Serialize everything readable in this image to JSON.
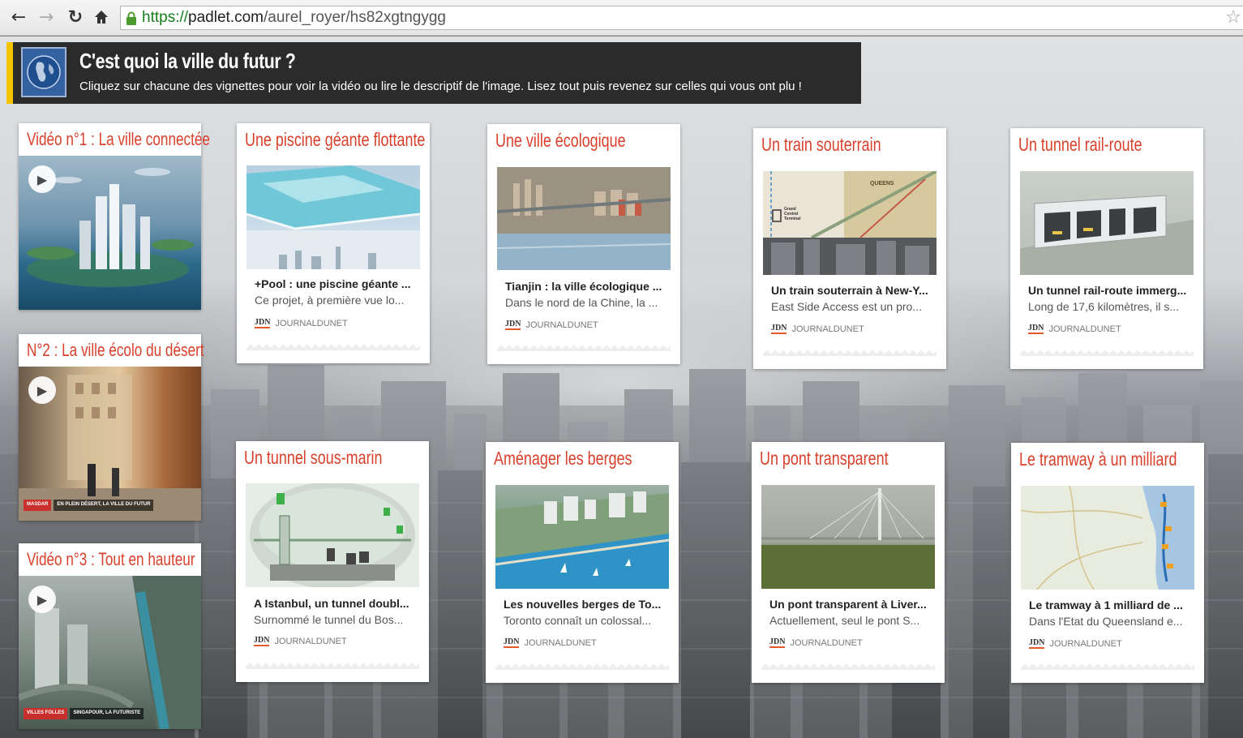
{
  "browser": {
    "url_scheme": "https://",
    "url_host": "padlet.com",
    "url_path": "/aurel_royer/hs82xgtngygg"
  },
  "header": {
    "title": "C'est quoi la ville du futur ?",
    "subtitle": "Cliquez sur chacune des vignettes pour voir la vidéo ou lire le descriptif de l'image. Lisez tout puis revenez sur celles qui vous ont plu !"
  },
  "videos": [
    {
      "title": "Vidéo n°1 : La ville connectée",
      "captions": []
    },
    {
      "title": "N°2 : La ville écolo du désert",
      "captions": [
        "MASDAR",
        "EN PLEIN DÉSERT, LA VILLE DU FUTUR"
      ]
    },
    {
      "title": "Vidéo n°3 : Tout en hauteur",
      "captions": [
        "VILLES FOLLES",
        "SINGAPOUR, LA FUTURISTE"
      ]
    }
  ],
  "cards": [
    {
      "title": "Une piscine géante flottante",
      "link_title": "+Pool : une piscine géante ...",
      "link_desc": "Ce projet, à première vue lo...",
      "source": "JOURNALDUNET",
      "logo": "JDN"
    },
    {
      "title": "Une ville écologique",
      "link_title": "Tianjin : la ville écologique ...",
      "link_desc": "Dans le nord de la Chine, la ...",
      "source": "JOURNALDUNET",
      "logo": "JDN"
    },
    {
      "title": "Un train souterrain",
      "link_title": "Un train souterrain à New-Y...",
      "link_desc": "East Side Access est un pro...",
      "source": "JOURNALDUNET",
      "logo": "JDN",
      "map_labels": [
        "QUEENS",
        "Grand Central Terminal"
      ]
    },
    {
      "title": "Un tunnel rail-route",
      "link_title": "Un tunnel rail-route immerg...",
      "link_desc": "Long de 17,6 kilomètres, il s...",
      "source": "JOURNALDUNET",
      "logo": "JDN"
    },
    {
      "title": "Un tunnel sous-marin",
      "link_title": "A Istanbul, un tunnel doubl...",
      "link_desc": "Surnommé le tunnel du Bos...",
      "source": "JOURNALDUNET",
      "logo": "JDN"
    },
    {
      "title": "Aménager les berges",
      "link_title": "Les nouvelles berges de To...",
      "link_desc": "Toronto connaît un colossal...",
      "source": "JOURNALDUNET",
      "logo": "JDN"
    },
    {
      "title": "Un pont transparent",
      "link_title": "Un pont transparent à Liver...",
      "link_desc": "Actuellement, seul le pont S...",
      "source": "JOURNALDUNET",
      "logo": "JDN"
    },
    {
      "title": "Le tramway à un milliard",
      "link_title": "Le tramway à 1 milliard de ...",
      "link_desc": "Dans l'Etat du Queensland e...",
      "source": "JOURNALDUNET",
      "logo": "JDN"
    }
  ],
  "colors": {
    "accent_red": "#d9402b",
    "header_bg": "#2b2b2b",
    "header_bar": "#f5c400",
    "secure_green": "#137e1b"
  },
  "icons": {
    "back": "back-arrow-icon",
    "forward": "forward-arrow-icon",
    "reload": "reload-icon",
    "home": "home-icon",
    "lock": "lock-icon",
    "bookmark": "star-icon",
    "play": "play-icon",
    "globe": "globe-icon"
  }
}
